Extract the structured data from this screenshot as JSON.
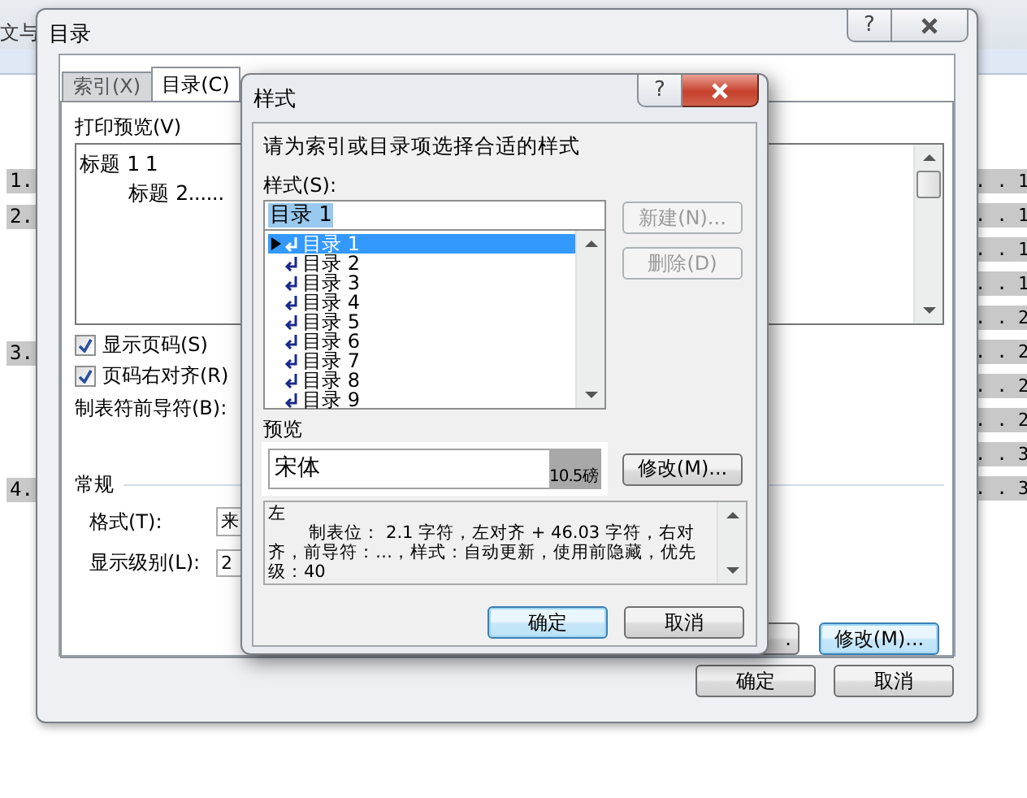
{
  "document": {
    "top_text": "文与",
    "numbers": [
      "1.",
      "2.",
      "3.",
      "4."
    ],
    "page_refs": [
      ". . 1",
      ". . 1",
      ". . 1",
      ". . 1",
      ". . 2",
      ". . 2",
      ". . 2",
      ". . 2",
      ". . 3",
      ". . 3"
    ]
  },
  "toc_dialog": {
    "title": "目录",
    "help": "?",
    "tabs": [
      {
        "label": "索引(X)",
        "selected": false
      },
      {
        "label": "目录(C)",
        "selected": true
      }
    ],
    "print_preview": {
      "label": "打印预览(V)",
      "lines": [
        "标题 1 1",
        "标题 2......"
      ]
    },
    "checkboxes": [
      {
        "label": "显示页码(S)",
        "checked": true
      },
      {
        "label": "页码右对齐(R)",
        "checked": true
      }
    ],
    "leader_label": "制表符前导符(B):",
    "general": {
      "heading": "常规",
      "format_label": "格式(T):",
      "format_value": "来",
      "level_label": "显示级别(L):",
      "level_value": "2"
    },
    "partial_button": ".",
    "modify_button": "修改(M)...",
    "buttons": [
      "确定",
      "取消"
    ]
  },
  "style_dialog": {
    "title": "样式",
    "help": "?",
    "instruction": "请为索引或目录项选择合适的样式",
    "styles_label": "样式(S):",
    "style_value": "目录 1",
    "styles": [
      {
        "label": "目录 1",
        "selected": true
      },
      {
        "label": "目录 2",
        "selected": false
      },
      {
        "label": "目录 3",
        "selected": false
      },
      {
        "label": "目录 4",
        "selected": false
      },
      {
        "label": "目录 5",
        "selected": false
      },
      {
        "label": "目录 6",
        "selected": false
      },
      {
        "label": "目录 7",
        "selected": false
      },
      {
        "label": "目录 8",
        "selected": false
      },
      {
        "label": "目录 9",
        "selected": false
      }
    ],
    "side_buttons": [
      {
        "label": "新建(N)...",
        "disabled": true
      },
      {
        "label": "删除(D)",
        "disabled": true
      }
    ],
    "preview_label": "预览",
    "preview_font": "宋体",
    "preview_size": "10.5磅",
    "modify_button": "修改(M)...",
    "description": [
      "左",
      "制表位： 2.1 字符，左对齐 + 46.03 字符，右对齐，前导符：…，样式：自动更新，使用前隐藏，优先级：40"
    ],
    "buttons": [
      "确定",
      "取消"
    ]
  }
}
